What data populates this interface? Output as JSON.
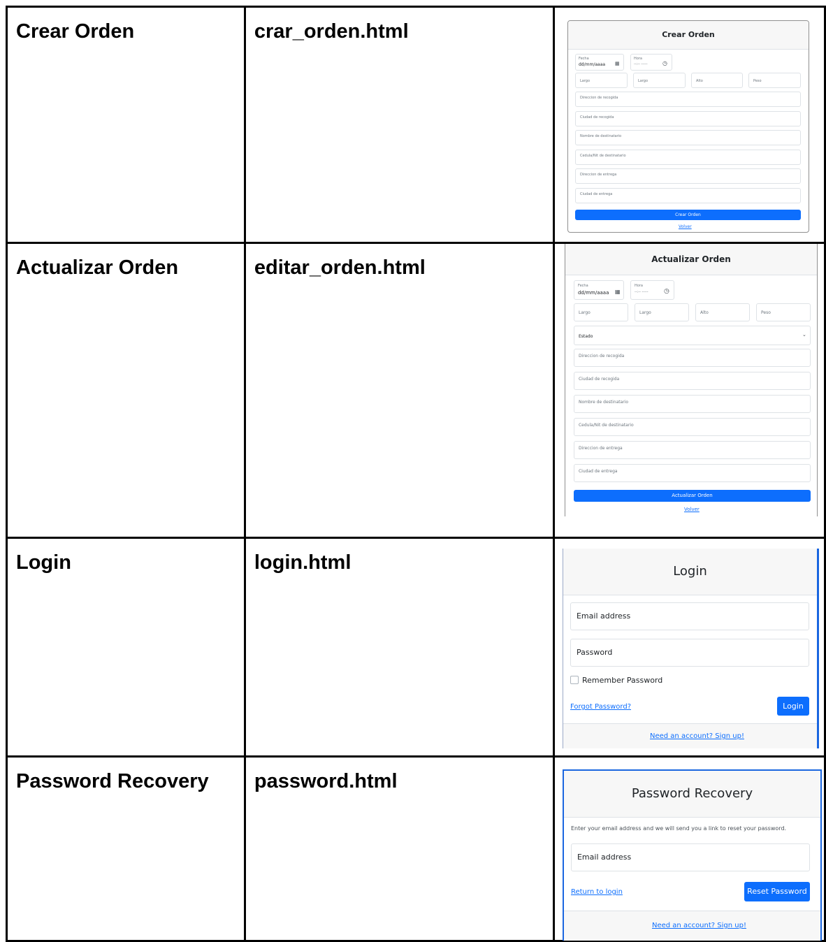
{
  "rows": [
    {
      "title": "Crear Orden",
      "file": "crar_orden.html",
      "screenshot": {
        "header": "Crear Orden",
        "fecha_label": "Fecha",
        "fecha_value": "dd/mm/aaaa",
        "hora_label": "Hora",
        "hora_value": "--:-- -----",
        "dims": [
          "Largo",
          "Largo",
          "Alto",
          "Peso"
        ],
        "fields": [
          "Direccion de recogida",
          "Ciudad de recogida",
          "Nombre de destinatario",
          "Cedula/Nit de destinatario",
          "Direccion de entrega",
          "Ciudad de entrega"
        ],
        "button": "Crear Orden",
        "link": "Volver"
      }
    },
    {
      "title": "Actualizar Orden",
      "file": "editar_orden.html",
      "screenshot": {
        "header": "Actualizar Orden",
        "fecha_label": "Fecha",
        "fecha_value": "dd/mm/aaaa",
        "hora_label": "Hora",
        "hora_value": "--:-- -----",
        "dims": [
          "Largo",
          "Largo",
          "Alto",
          "Peso"
        ],
        "estado": "Estado",
        "fields": [
          "Direccion de recogida",
          "Ciudad de recogida",
          "Nombre de destinatario",
          "Cedula/Nit de destinatario",
          "Direccion de entrega",
          "Ciudad de entrega"
        ],
        "button": "Actualizar Orden",
        "link": "Volver"
      }
    },
    {
      "title": "Login",
      "file": "login.html",
      "screenshot": {
        "header": "Login",
        "email": "Email address",
        "password": "Password",
        "remember": "Remember Password",
        "forgot": "Forgot Password?",
        "button": "Login",
        "signup": "Need an account? Sign up!"
      }
    },
    {
      "title": "Password Recovery",
      "file": "password.html",
      "screenshot": {
        "header": "Password Recovery",
        "instructions": "Enter your email address and we will send you a link to reset your password.",
        "email": "Email address",
        "return": "Return to login",
        "button": "Reset Password",
        "signup": "Need an account? Sign up!"
      }
    }
  ],
  "colors": {
    "primary": "#0d6efd",
    "header_bg": "#f7f7f7",
    "border": "#000000"
  }
}
